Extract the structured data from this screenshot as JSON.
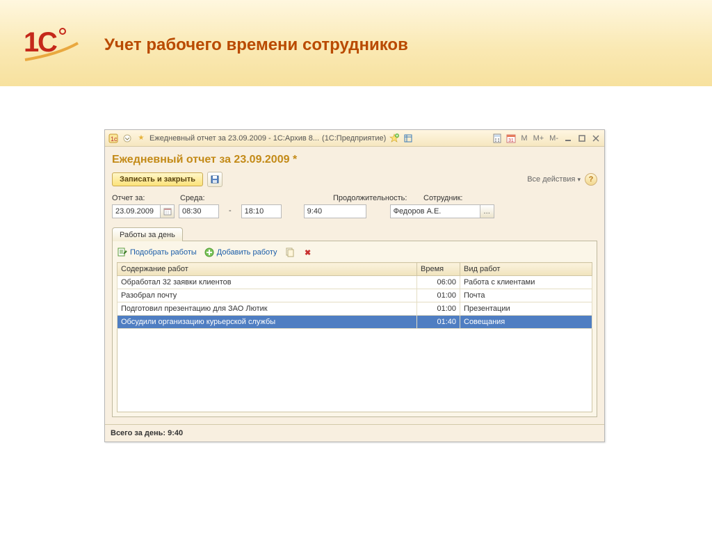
{
  "slide": {
    "title": "Учет рабочего времени сотрудников"
  },
  "window": {
    "title": "Ежедневный отчет за 23.09.2009 - 1С:Архив 8...",
    "mode": "(1С:Предприятие)",
    "mmm": [
      "M",
      "M+",
      "M-"
    ]
  },
  "doc": {
    "title": "Ежедневный отчет за 23.09.2009 *",
    "save_close": "Записать и закрыть",
    "all_actions": "Все действия",
    "labels": {
      "date": "Отчет за:",
      "day": "Среда:",
      "duration": "Продолжительность:",
      "employee": "Сотрудник:"
    },
    "values": {
      "date": "23.09.2009",
      "start": "08:30",
      "end": "18:10",
      "duration": "9:40",
      "employee": "Федоров А.Е."
    },
    "tab": "Работы за день",
    "toolbar": {
      "pick": "Подобрать работы",
      "add": "Добавить работу"
    },
    "columns": {
      "content": "Содержание работ",
      "time": "Время",
      "type": "Вид работ"
    },
    "rows": [
      {
        "content": "Обработал 32 заявки клиентов",
        "time": "06:00",
        "type": "Работа с клиентами",
        "selected": false
      },
      {
        "content": "Разобрал почту",
        "time": "01:00",
        "type": "Почта",
        "selected": false
      },
      {
        "content": "Подготовил презентацию для ЗАО Лютик",
        "time": "01:00",
        "type": "Презентации",
        "selected": false
      },
      {
        "content": "Обсудили организацию курьерской службы",
        "time": "01:40",
        "type": "Совещания",
        "selected": true
      }
    ],
    "footer_label": "Всего за день:",
    "footer_value": "9:40"
  }
}
